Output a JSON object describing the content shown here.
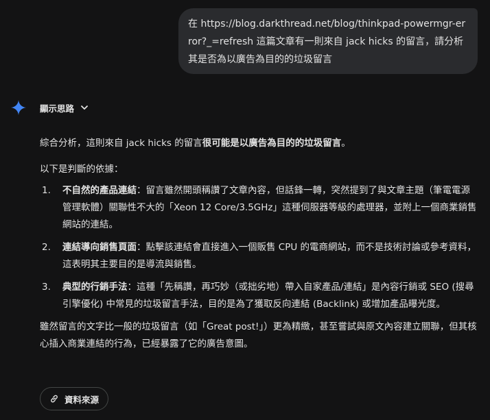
{
  "user_message": {
    "text": "在 https://blog.darkthread.net/blog/thinkpad-powermgr-error?_=refresh 這篇文章有一則來自 jack hicks 的留言，請分析其是否為以廣告為目的的垃圾留言"
  },
  "response": {
    "thoughts_label": "顯示思路",
    "intro_plain": "綜合分析，這則來自 jack hicks 的留言",
    "intro_bold": "很可能是以廣告為目的的垃圾留言",
    "intro_end": "。",
    "basis_heading": "以下是判斷的依據：",
    "reasons": [
      {
        "num": "1.",
        "title": "不自然的產品連結",
        "text": "：留言雖然開頭稱讚了文章內容，但話鋒一轉，突然提到了與文章主題（筆電電源管理軟體）關聯性不大的「Xeon 12 Core/3.5GHz」這種伺服器等級的處理器，並附上一個商業銷售網站的連結。"
      },
      {
        "num": "2.",
        "title": "連結導向銷售頁面",
        "text": "：點擊該連結會直接進入一個販售 CPU 的電商網站，而不是技術討論或參考資料，這表明其主要目的是導流與銷售。"
      },
      {
        "num": "3.",
        "title": "典型的行銷手法",
        "text": "：這種「先稱讚，再巧妙（或拙劣地）帶入自家產品/連結」是內容行銷或 SEO (搜尋引擎優化) 中常見的垃圾留言手法，目的是為了獲取反向連結 (Backlink) 或增加產品曝光度。"
      }
    ],
    "conclusion": "雖然留言的文字比一般的垃圾留言（如「Great post!」）更為精緻，甚至嘗試與原文內容建立關聯，但其核心插入商業連結的行為，已經暴露了它的廣告意圖。",
    "sources_label": "資料來源"
  },
  "icons": {
    "assistant": "sparkle-icon",
    "expand": "chevron-down-icon",
    "sources": "link-icon"
  },
  "colors": {
    "background": "#131314",
    "user_bubble": "#2a2b2e",
    "text": "#e3e3e3",
    "sparkle": "#4285f4",
    "button_border": "#444746"
  }
}
